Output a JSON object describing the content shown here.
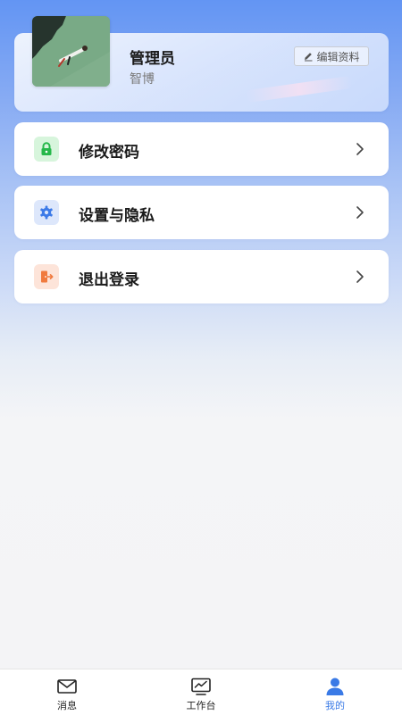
{
  "profile": {
    "name": "管理员",
    "org": "智博",
    "edit_label": "编辑资料",
    "avatar_icon": "avatar-photo-icon"
  },
  "menu": {
    "items": [
      {
        "label": "修改密码",
        "icon": "lock-icon",
        "icon_bg": "#d7f5dc",
        "icon_color": "#25b84a"
      },
      {
        "label": "设置与隐私",
        "icon": "gear-icon",
        "icon_bg": "#dde7fb",
        "icon_color": "#3d7be8"
      },
      {
        "label": "退出登录",
        "icon": "logout-door-icon",
        "icon_bg": "#fde4d9",
        "icon_color": "#f07a3e"
      }
    ]
  },
  "tabbar": {
    "tabs": [
      {
        "label": "消息",
        "icon": "mail-icon",
        "active": false
      },
      {
        "label": "工作台",
        "icon": "monitor-chart-icon",
        "active": false
      },
      {
        "label": "我的",
        "icon": "user-icon",
        "active": true
      }
    ],
    "active_color": "#3a7ae6"
  }
}
